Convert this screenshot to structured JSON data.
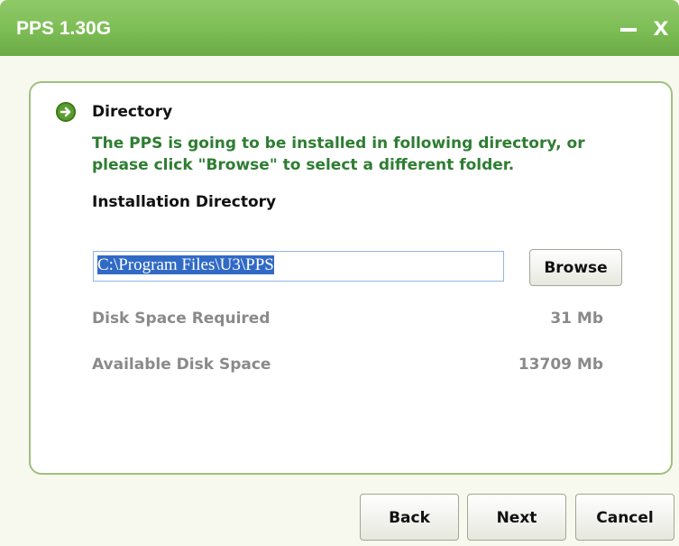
{
  "window": {
    "title": "PPS 1.30G",
    "close_glyph": "x"
  },
  "section": {
    "heading": "Directory",
    "description": "The PPS is going to be installed in following directory, or please click \"Browse\" to select a different folder.",
    "subheading": "Installation Directory"
  },
  "directory": {
    "value": "C:\\Program Files\\U3\\PPS"
  },
  "buttons": {
    "browse": "Browse",
    "back": "Back",
    "next": "Next",
    "cancel": "Cancel"
  },
  "disk": {
    "required_label": "Disk Space Required",
    "required_value": "31 Mb",
    "available_label": "Available Disk Space",
    "available_value": "13709 Mb"
  },
  "colors": {
    "title_bar": "#7dbd55",
    "accent_text": "#2e7d32",
    "selection": "#316ac5"
  },
  "icons": {
    "section": "arrow-right-circle-icon",
    "minimize": "minimize-icon",
    "close": "close-icon"
  }
}
